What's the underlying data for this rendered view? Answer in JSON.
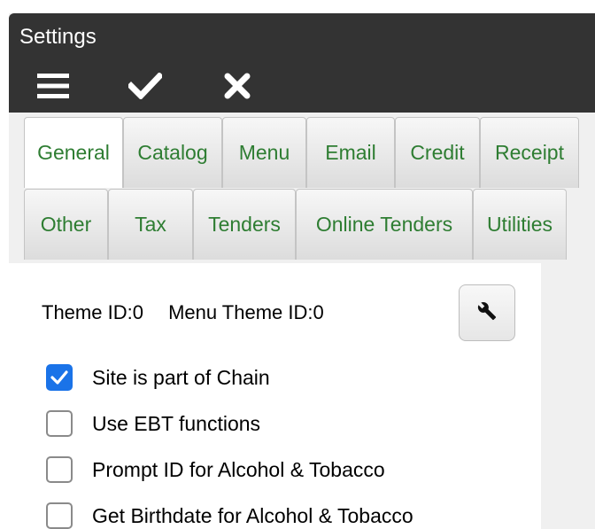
{
  "window": {
    "title": "Settings"
  },
  "toolbar": {
    "menu_icon": "hamburger-menu-icon",
    "save_icon": "checkmark-icon",
    "cancel_icon": "close-x-icon"
  },
  "tabs": {
    "row1": [
      {
        "label": "General",
        "active": true
      },
      {
        "label": "Catalog",
        "active": false
      },
      {
        "label": "Menu",
        "active": false
      },
      {
        "label": "Email",
        "active": false
      },
      {
        "label": "Credit",
        "active": false
      },
      {
        "label": "Receipt",
        "active": false
      }
    ],
    "row2": [
      {
        "label": "Other",
        "active": false
      },
      {
        "label": "Tax",
        "active": false
      },
      {
        "label": "Tenders",
        "active": false
      },
      {
        "label": "Online Tenders",
        "active": false
      },
      {
        "label": "Utilities",
        "active": false
      }
    ]
  },
  "general": {
    "theme_id": "Theme ID:0",
    "menu_theme_id": "Menu Theme ID:0",
    "tool_icon": "wrench-icon",
    "options": [
      {
        "label": "Site is part of Chain",
        "checked": true
      },
      {
        "label": "Use EBT functions",
        "checked": false
      },
      {
        "label": "Prompt ID for Alcohol & Tobacco",
        "checked": false
      },
      {
        "label": "Get Birthdate for Alcohol & Tobacco",
        "checked": false
      }
    ]
  },
  "colors": {
    "titlebar": "#333333",
    "tab_text": "#2e7d32",
    "checkbox_checked": "#1a73e8"
  }
}
